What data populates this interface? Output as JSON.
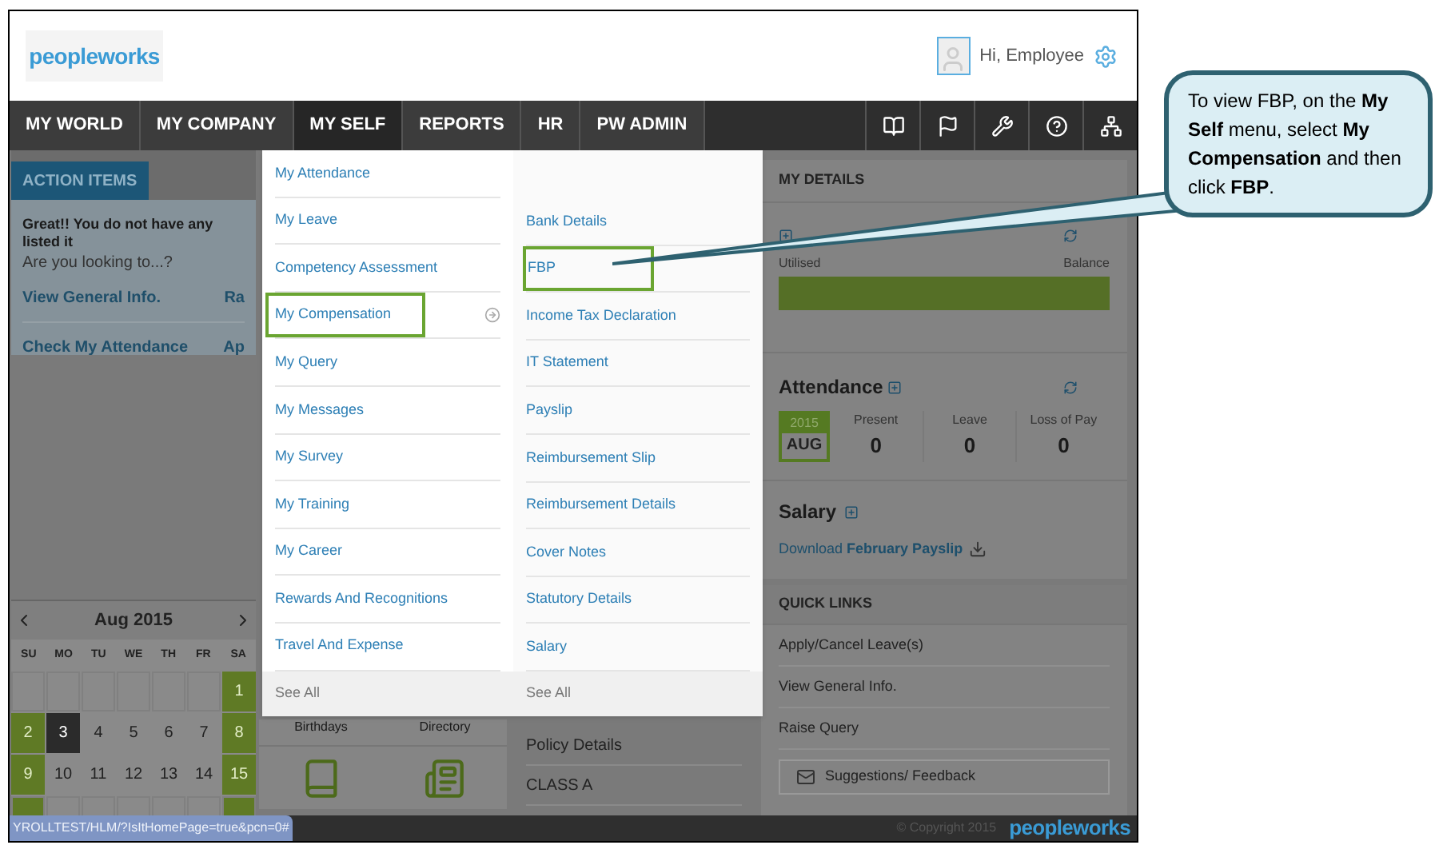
{
  "header": {
    "logo": "peopleworks",
    "greeting": "Hi, Employee"
  },
  "nav": {
    "tabs": [
      {
        "label": "MY WORLD",
        "selected": false
      },
      {
        "label": "MY COMPANY",
        "selected": false
      },
      {
        "label": "MY SELF",
        "selected": true
      },
      {
        "label": "REPORTS",
        "selected": false
      },
      {
        "label": "HR",
        "selected": false
      },
      {
        "label": "PW ADMIN",
        "selected": false
      }
    ]
  },
  "action_items": {
    "tab": "ACTION ITEMS",
    "message": "Great!! You do not have any listed it",
    "prompt": "Are you looking to...?",
    "links": [
      [
        "View General Info.",
        "Ra"
      ],
      [
        "Check My Attendance",
        "Ap"
      ]
    ]
  },
  "calendar": {
    "month": "Aug 2015",
    "weekdays": [
      "SU",
      "MO",
      "TU",
      "WE",
      "TH",
      "FR",
      "SA"
    ],
    "weeks": [
      [
        {
          "kind": "blank",
          "weekend": false
        },
        {
          "kind": "blank",
          "weekend": false
        },
        {
          "kind": "blank",
          "weekend": false
        },
        {
          "kind": "blank",
          "weekend": false
        },
        {
          "kind": "blank",
          "weekend": false
        },
        {
          "kind": "blank",
          "weekend": false
        },
        {
          "kind": "day",
          "day": "1",
          "weekend": true,
          "selected": false
        }
      ],
      [
        {
          "kind": "day",
          "day": "2",
          "weekend": true,
          "selected": false
        },
        {
          "kind": "day",
          "day": "3",
          "weekend": false,
          "selected": true
        },
        {
          "kind": "day",
          "day": "4",
          "weekend": false,
          "selected": false
        },
        {
          "kind": "day",
          "day": "5",
          "weekend": false,
          "selected": false
        },
        {
          "kind": "day",
          "day": "6",
          "weekend": false,
          "selected": false
        },
        {
          "kind": "day",
          "day": "7",
          "weekend": false,
          "selected": false
        },
        {
          "kind": "day",
          "day": "8",
          "weekend": true,
          "selected": false
        }
      ],
      [
        {
          "kind": "day",
          "day": "9",
          "weekend": true,
          "selected": false
        },
        {
          "kind": "day",
          "day": "10",
          "weekend": false,
          "selected": false
        },
        {
          "kind": "day",
          "day": "11",
          "weekend": false,
          "selected": false
        },
        {
          "kind": "day",
          "day": "12",
          "weekend": false,
          "selected": false
        },
        {
          "kind": "day",
          "day": "13",
          "weekend": false,
          "selected": false
        },
        {
          "kind": "day",
          "day": "14",
          "weekend": false,
          "selected": false
        },
        {
          "kind": "day",
          "day": "15",
          "weekend": true,
          "selected": false
        }
      ],
      [
        {
          "kind": "blank",
          "weekend": true
        },
        {
          "kind": "blank",
          "weekend": false
        },
        {
          "kind": "blank",
          "weekend": false
        },
        {
          "kind": "blank",
          "weekend": false
        },
        {
          "kind": "blank",
          "weekend": false
        },
        {
          "kind": "blank",
          "weekend": false
        },
        {
          "kind": "blank",
          "weekend": true
        }
      ]
    ]
  },
  "widgets": {
    "tiles": [
      "Birthdays",
      "Directory"
    ],
    "policy": [
      "Policy Details",
      "CLASS A"
    ]
  },
  "my_details": {
    "title": "MY DETAILS",
    "leave": {
      "left": "Utilised",
      "right": "Balance"
    },
    "attendance": {
      "title": "Attendance",
      "year": "2015",
      "month": "AUG",
      "stats": [
        {
          "label": "Present",
          "value": "0"
        },
        {
          "label": "Leave",
          "value": "0"
        },
        {
          "label": "Loss of Pay",
          "value": "0"
        }
      ]
    },
    "salary": {
      "title": "Salary",
      "prefix": "Download",
      "link": "February Payslip"
    }
  },
  "quick_links": {
    "title": "QUICK LINKS",
    "items": [
      "Apply/Cancel Leave(s)",
      "View General Info.",
      "Raise Query"
    ],
    "feedback": "Suggestions/ Feedback"
  },
  "menu": {
    "left": [
      {
        "label": "My Attendance",
        "highlighted": false,
        "submenu": false
      },
      {
        "label": "My Leave",
        "highlighted": false,
        "submenu": false
      },
      {
        "label": "Competency Assessment",
        "highlighted": false,
        "submenu": false
      },
      {
        "label": "My Compensation",
        "highlighted": true,
        "submenu": true
      },
      {
        "label": "My Query",
        "highlighted": false,
        "submenu": false
      },
      {
        "label": "My Messages",
        "highlighted": false,
        "submenu": false
      },
      {
        "label": "My Survey",
        "highlighted": false,
        "submenu": false
      },
      {
        "label": "My Training",
        "highlighted": false,
        "submenu": false
      },
      {
        "label": "My Career",
        "highlighted": false,
        "submenu": false
      },
      {
        "label": "Rewards And Recognitions",
        "highlighted": false,
        "submenu": false
      },
      {
        "label": "Travel And Expense",
        "highlighted": false,
        "submenu": false
      }
    ],
    "right": [
      {
        "label": "Bank Details",
        "highlighted": false
      },
      {
        "label": "FBP",
        "highlighted": true
      },
      {
        "label": "Income Tax Declaration",
        "highlighted": false
      },
      {
        "label": "IT Statement",
        "highlighted": false
      },
      {
        "label": "Payslip",
        "highlighted": false
      },
      {
        "label": "Reimbursement Slip",
        "highlighted": false
      },
      {
        "label": "Reimbursement Details",
        "highlighted": false
      },
      {
        "label": "Cover Notes",
        "highlighted": false
      },
      {
        "label": "Statutory Details",
        "highlighted": false
      },
      {
        "label": "Salary",
        "highlighted": false
      }
    ],
    "see_all": [
      "See All",
      "See All"
    ]
  },
  "footer": {
    "url": "YROLLTEST/HLM/?IsItHomePage=true&pcn=0#",
    "copyright": "© Copyright 2015",
    "logo": "peopleworks"
  },
  "callout": {
    "text": "To view FBP, on the **My Self** menu, select **My Compensation** and then click **FBP**."
  }
}
